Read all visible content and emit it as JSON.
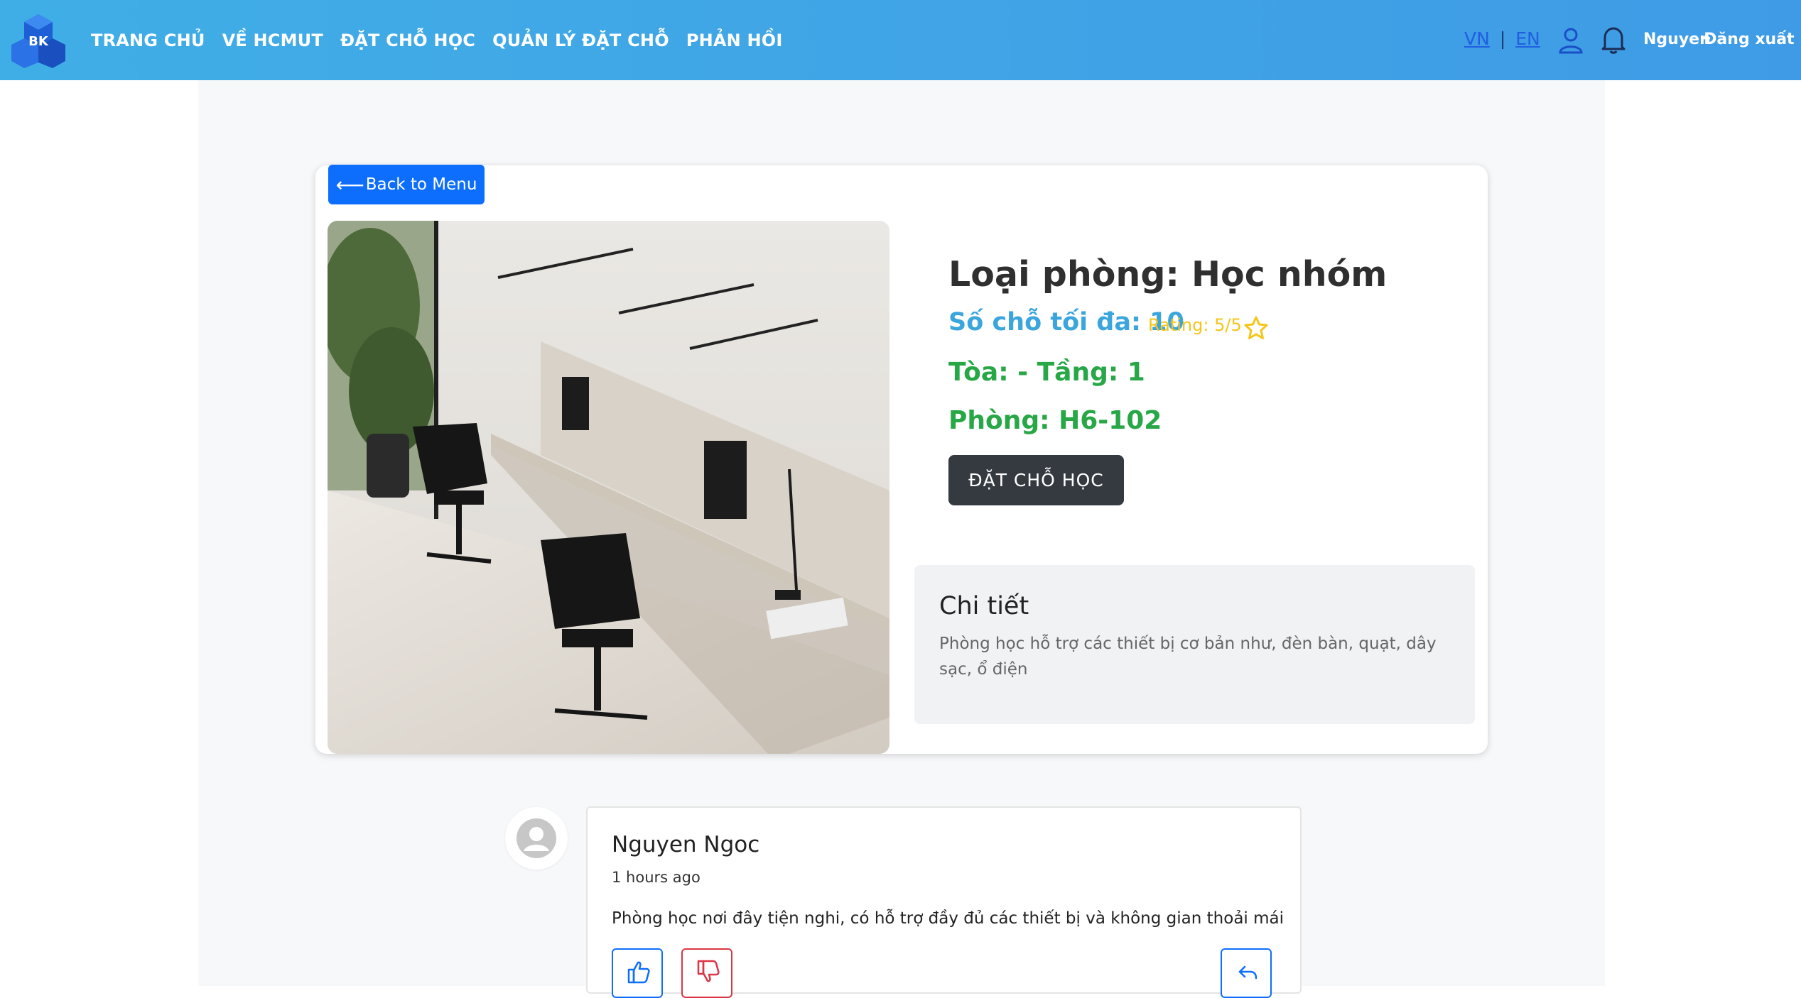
{
  "header": {
    "logo_text": "BK",
    "nav": [
      "TRANG CHỦ",
      "VỀ HCMUT",
      "ĐẶT CHỖ HỌC",
      "QUẢN LÝ ĐẶT CHỖ",
      "PHẢN HỒI"
    ],
    "lang_vn": "VN",
    "lang_sep": "|",
    "lang_en": "EN",
    "user_name": "Nguyen",
    "logout": "Đăng xuất",
    "colors": {
      "gradient_start": "#40aee6",
      "gradient_end": "#3f9be6"
    }
  },
  "room": {
    "back_label": "Back to Menu",
    "title": "Loại phòng: Học nhóm",
    "capacity": "Số chỗ tối đa: 10",
    "rating": "Rating: 5/5",
    "building": "Tòa: - Tầng: 1",
    "room_no": "Phòng: H6-102",
    "book_label": "ĐẶT CHỖ HỌC",
    "detail_title": "Chi tiết",
    "detail_text": "Phòng học hỗ trợ các thiết bị cơ bản như, đèn bàn, quạt, dây sạc, ổ điện",
    "colors": {
      "capacity": "#3ba5dd",
      "rating": "#f5c518",
      "location": "#27a745",
      "book_button": "#343a40",
      "back_button": "#0d6efd"
    }
  },
  "comment": {
    "author": "Nguyen Ngoc",
    "time": "1 hours ago",
    "text": "Phòng học nơi đây tiện nghi, có hỗ trợ đầy đủ các thiết bị và không gian thoải mái",
    "icons": [
      "thumbs-up-icon",
      "thumbs-down-icon",
      "reply-icon"
    ]
  }
}
